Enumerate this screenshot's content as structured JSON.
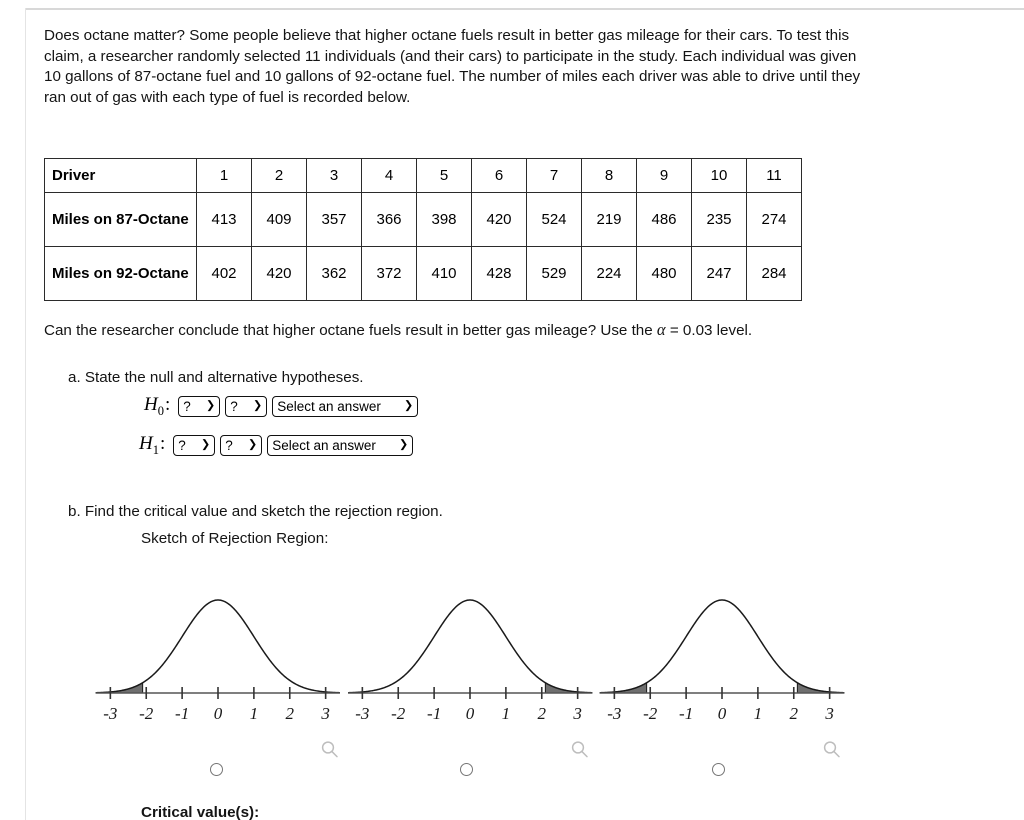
{
  "intro": {
    "paragraph": "Does octane matter? Some people believe that higher octane fuels result in better gas mileage for their cars. To test this claim, a researcher randomly selected 11 individuals (and their cars) to participate in the study. Each individual was given 10 gallons of 87-octane fuel and 10 gallons of 92-octane fuel. The number of miles each driver was able to drive until they ran out of gas with each type of fuel is recorded below."
  },
  "table": {
    "header_label": "Driver",
    "driver_numbers": [
      "1",
      "2",
      "3",
      "4",
      "5",
      "6",
      "7",
      "8",
      "9",
      "10",
      "11"
    ],
    "rows": [
      {
        "label": "Miles on 87-Octane",
        "values": [
          "413",
          "409",
          "357",
          "366",
          "398",
          "420",
          "524",
          "219",
          "486",
          "235",
          "274"
        ]
      },
      {
        "label": "Miles on 92-Octane",
        "values": [
          "402",
          "420",
          "362",
          "372",
          "410",
          "428",
          "529",
          "224",
          "480",
          "247",
          "284"
        ]
      }
    ]
  },
  "conclude": {
    "text_before": "Can the researcher conclude that higher octane fuels result in better gas mileage? Use the ",
    "alpha_symbol": "α",
    "text_after": " = 0.03 level."
  },
  "part_a": {
    "label": "a. State the null and alternative hypotheses.",
    "hypotheses": [
      {
        "name": "H0",
        "symbol": "H",
        "subscript": "0",
        "colon": ":",
        "select1_value": "?",
        "select2_value": "?",
        "select3_value": "Select an answer"
      },
      {
        "name": "H1",
        "symbol": "H",
        "subscript": "1",
        "colon": ":",
        "select1_value": "?",
        "select2_value": "?",
        "select3_value": "Select an answer"
      }
    ]
  },
  "part_b": {
    "label": "b. Find the critical value and sketch the rejection region.",
    "sketch_label": "Sketch of Rejection Region:",
    "critical_value_label": "Critical value(s):"
  },
  "chart_data": [
    {
      "type": "line",
      "title": "",
      "variant": "left-tailed",
      "xlabel": "",
      "ylabel": "",
      "xlim": [
        -3.4,
        3.4
      ],
      "tick_labels": [
        "-3",
        "-2",
        "-1",
        "0",
        "1",
        "2",
        "3"
      ],
      "tick_values": [
        -3,
        -2,
        -1,
        0,
        1,
        2,
        3
      ],
      "curve": "standard normal density",
      "shaded_regions": [
        {
          "from": -3.4,
          "to": -2.1
        }
      ],
      "grid": false,
      "legend": "none"
    },
    {
      "type": "line",
      "title": "",
      "variant": "right-tailed",
      "xlabel": "",
      "ylabel": "",
      "xlim": [
        -3.4,
        3.4
      ],
      "tick_labels": [
        "-3",
        "-2",
        "-1",
        "0",
        "1",
        "2",
        "3"
      ],
      "tick_values": [
        -3,
        -2,
        -1,
        0,
        1,
        2,
        3
      ],
      "curve": "standard normal density",
      "shaded_regions": [
        {
          "from": 2.1,
          "to": 3.4
        }
      ],
      "grid": false,
      "legend": "none"
    },
    {
      "type": "line",
      "title": "",
      "variant": "two-tailed",
      "xlabel": "",
      "ylabel": "",
      "xlim": [
        -3.4,
        3.4
      ],
      "tick_labels": [
        "-3",
        "-2",
        "-1",
        "0",
        "1",
        "2",
        "3"
      ],
      "tick_values": [
        -3,
        -2,
        -1,
        0,
        1,
        2,
        3
      ],
      "curve": "standard normal density",
      "shaded_regions": [
        {
          "from": -3.4,
          "to": -2.1
        },
        {
          "from": 2.1,
          "to": 3.4
        }
      ],
      "grid": false,
      "legend": "none"
    }
  ],
  "icons": {
    "magnifier": "search-icon",
    "chevron": "⌄"
  },
  "colors": {
    "text": "#141414",
    "rule": "#d8d8d8",
    "table_border": "#2b2b2b",
    "curve": "#1a1a1a",
    "shade": "#6f6f6f",
    "radio_border": "#767676",
    "magnifier": "#bdbdbd"
  }
}
